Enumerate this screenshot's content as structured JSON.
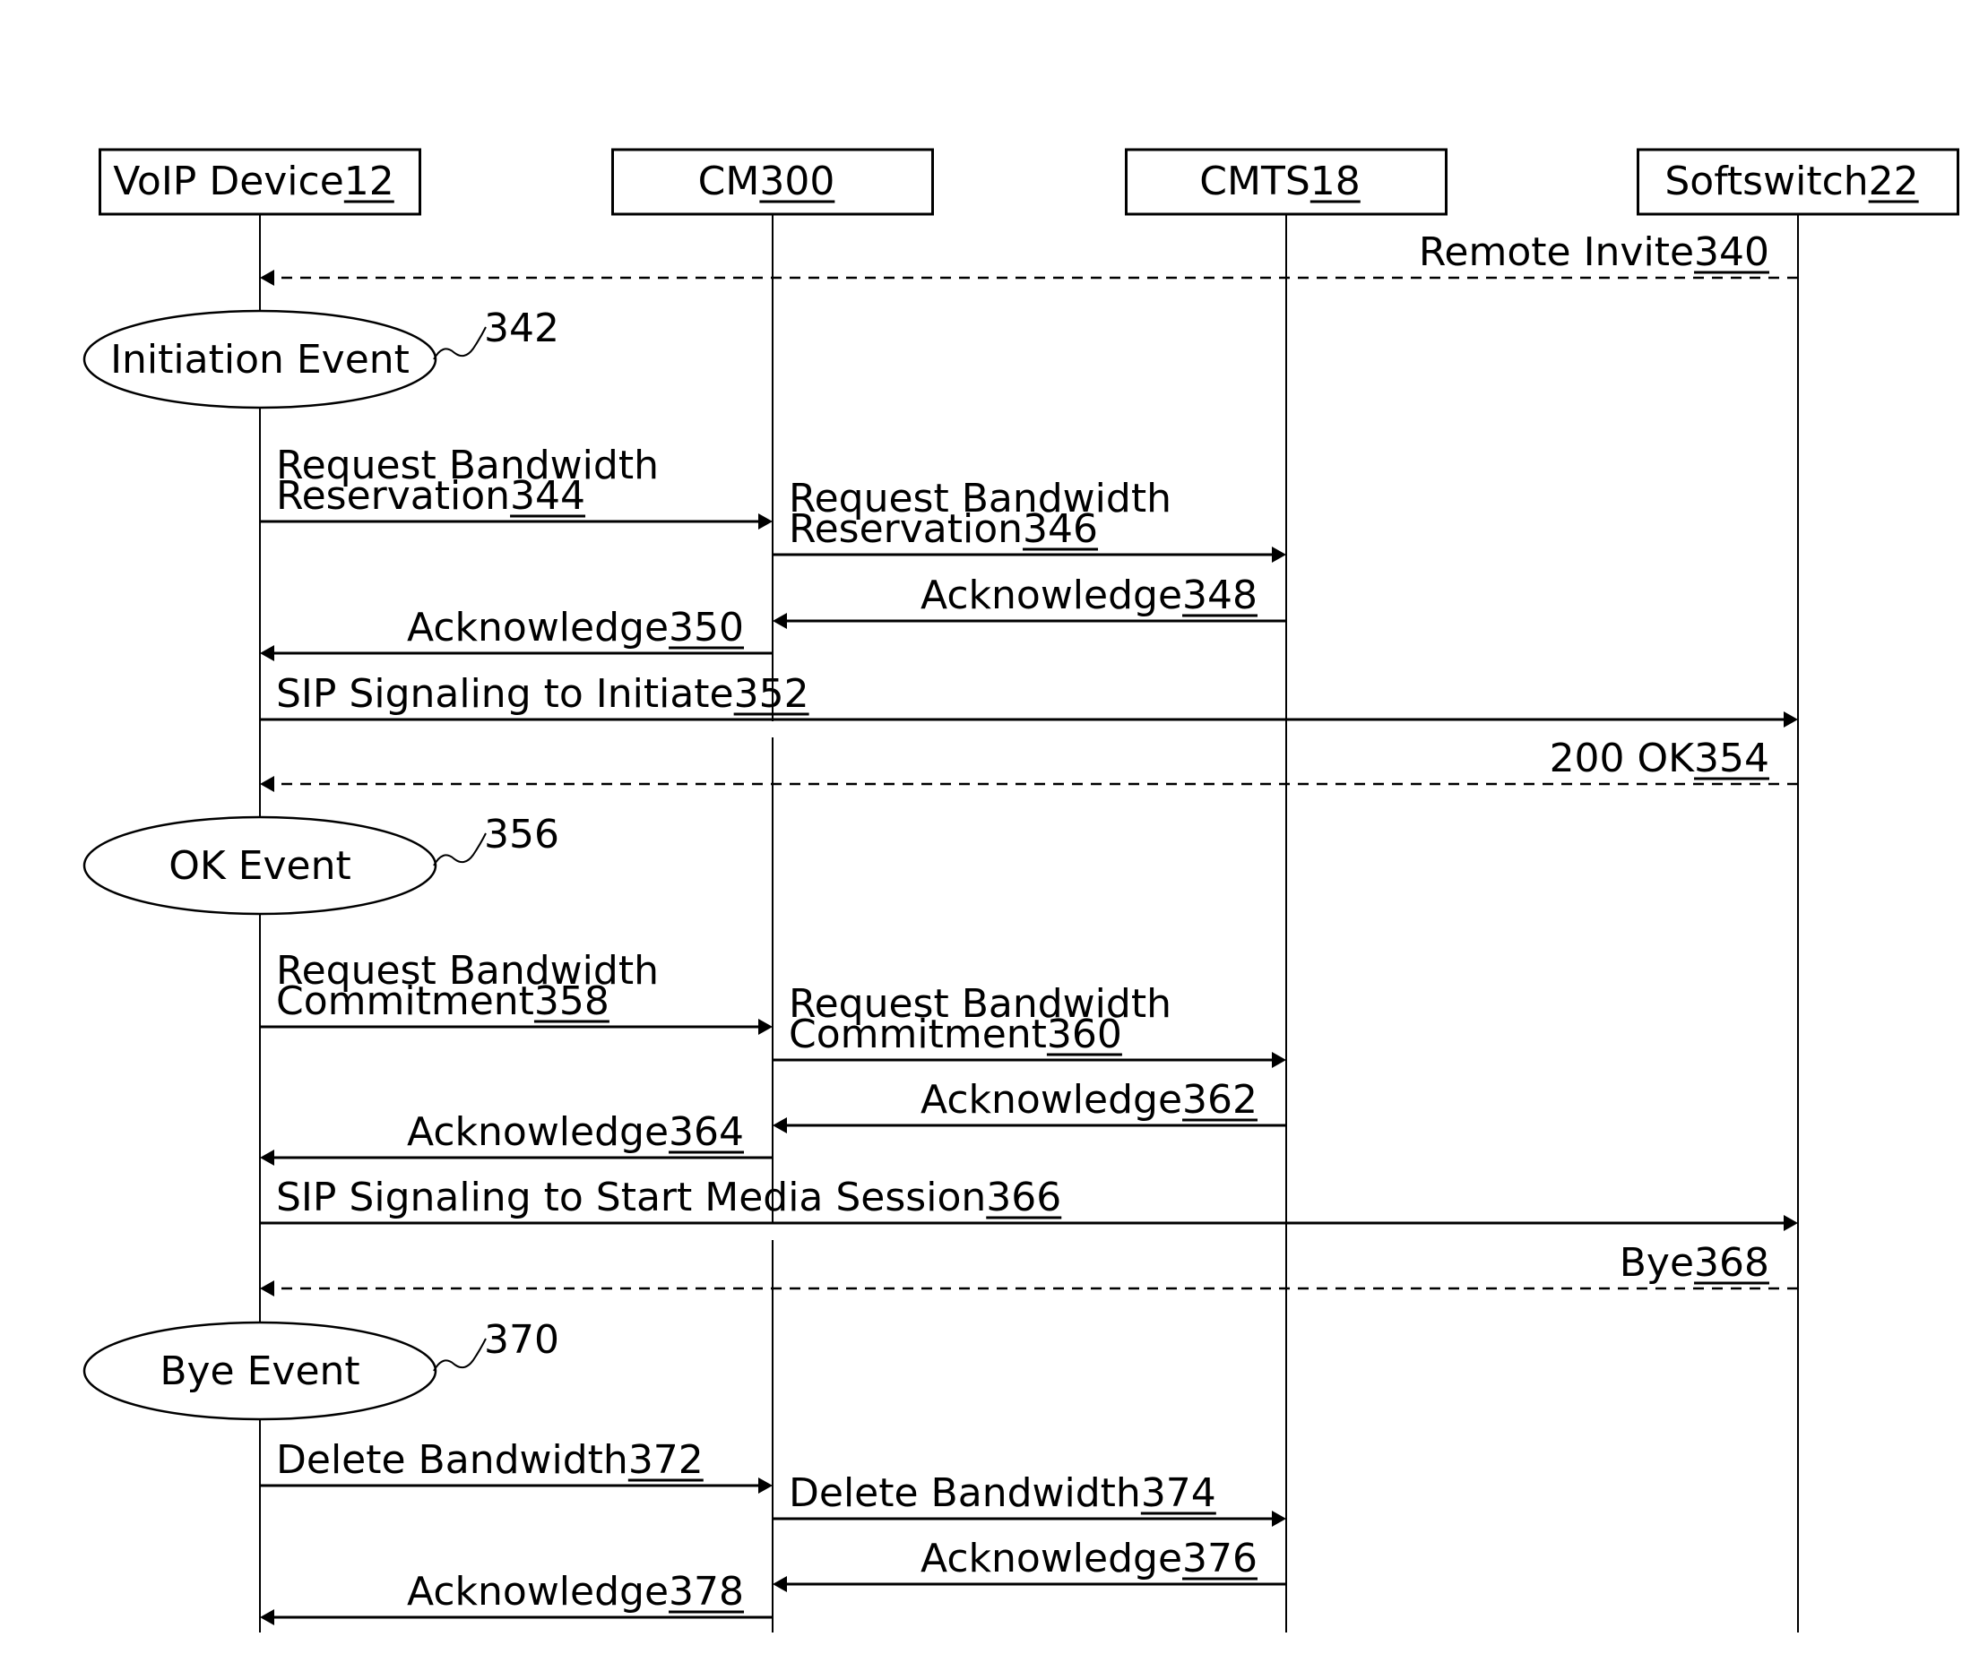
{
  "diagram": {
    "type": "sequence-diagram",
    "participants": [
      {
        "id": "voip",
        "name": "VoIP Device",
        "ref": "12"
      },
      {
        "id": "cm",
        "name": "CM",
        "ref": "300"
      },
      {
        "id": "cmts",
        "name": "CMTS",
        "ref": "18"
      },
      {
        "id": "softswitch",
        "name": "Softswitch",
        "ref": "22"
      }
    ],
    "events": [
      {
        "label": "Initiation Event",
        "ref": "342",
        "on": "voip",
        "after": "340"
      },
      {
        "label": "OK Event",
        "ref": "356",
        "on": "voip",
        "after": "354"
      },
      {
        "label": "Bye Event",
        "ref": "370",
        "on": "voip",
        "after": "368"
      }
    ],
    "messages": [
      {
        "ref": "340",
        "lines": [
          "Remote Invite"
        ],
        "from": "softswitch",
        "to": "voip",
        "style": "dashed"
      },
      {
        "ref": "344",
        "lines": [
          "Request Bandwidth",
          "Reservation"
        ],
        "from": "voip",
        "to": "cm",
        "style": "solid"
      },
      {
        "ref": "346",
        "lines": [
          "Request Bandwidth",
          "Reservation"
        ],
        "from": "cm",
        "to": "cmts",
        "style": "solid"
      },
      {
        "ref": "348",
        "lines": [
          "Acknowledge"
        ],
        "from": "cmts",
        "to": "cm",
        "style": "solid"
      },
      {
        "ref": "350",
        "lines": [
          "Acknowledge"
        ],
        "from": "cm",
        "to": "voip",
        "style": "solid"
      },
      {
        "ref": "352",
        "lines": [
          "SIP Signaling to Initiate"
        ],
        "from": "voip",
        "to": "softswitch",
        "style": "solid"
      },
      {
        "ref": "354",
        "lines": [
          "200 OK"
        ],
        "from": "softswitch",
        "to": "voip",
        "style": "dashed"
      },
      {
        "ref": "358",
        "lines": [
          "Request Bandwidth",
          "Commitment"
        ],
        "from": "voip",
        "to": "cm",
        "style": "solid"
      },
      {
        "ref": "360",
        "lines": [
          "Request Bandwidth",
          "Commitment"
        ],
        "from": "cm",
        "to": "cmts",
        "style": "solid"
      },
      {
        "ref": "362",
        "lines": [
          "Acknowledge"
        ],
        "from": "cmts",
        "to": "cm",
        "style": "solid"
      },
      {
        "ref": "364",
        "lines": [
          "Acknowledge"
        ],
        "from": "cm",
        "to": "voip",
        "style": "solid"
      },
      {
        "ref": "366",
        "lines": [
          "SIP Signaling to Start Media Session"
        ],
        "from": "voip",
        "to": "softswitch",
        "style": "solid"
      },
      {
        "ref": "368",
        "lines": [
          "Bye"
        ],
        "from": "softswitch",
        "to": "voip",
        "style": "dashed"
      },
      {
        "ref": "372",
        "lines": [
          "Delete Bandwidth"
        ],
        "from": "voip",
        "to": "cm",
        "style": "solid"
      },
      {
        "ref": "374",
        "lines": [
          "Delete Bandwidth"
        ],
        "from": "cm",
        "to": "cmts",
        "style": "solid"
      },
      {
        "ref": "376",
        "lines": [
          "Acknowledge"
        ],
        "from": "cmts",
        "to": "cm",
        "style": "solid"
      },
      {
        "ref": "378",
        "lines": [
          "Acknowledge"
        ],
        "from": "cm",
        "to": "voip",
        "style": "solid"
      }
    ]
  }
}
